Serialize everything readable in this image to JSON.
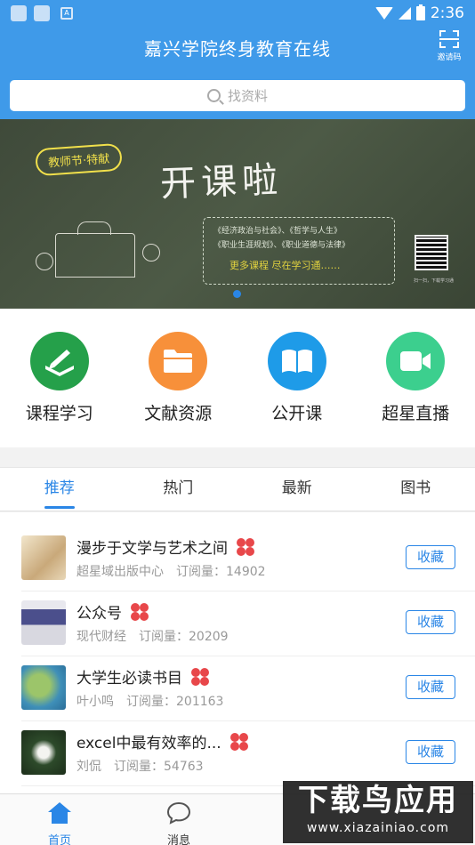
{
  "status_bar": {
    "time": "2:36"
  },
  "header": {
    "title": "嘉兴学院终身教育在线",
    "invite_label": "邀请码"
  },
  "search": {
    "placeholder": "找资料"
  },
  "banner": {
    "badge": "教师节·特献",
    "headline": "开课啦",
    "lines": [
      "《经济政治与社会》、《哲学与人生》",
      "《职业生涯规划》、《职业道德与法律》"
    ],
    "slogan": "更多课程 尽在学习通……",
    "qr_caption": "扫一扫，下载学习通"
  },
  "quick_menu": [
    {
      "label": "课程学习",
      "icon": "pen-book-icon",
      "color": "#25a04a"
    },
    {
      "label": "文献资源",
      "icon": "folder-icon",
      "color": "#f7903a"
    },
    {
      "label": "公开课",
      "icon": "open-book-icon",
      "color": "#1e9be8"
    },
    {
      "label": "超星直播",
      "icon": "video-camera-icon",
      "color": "#3ccf8e"
    }
  ],
  "tabs": [
    {
      "label": "推荐",
      "active": true
    },
    {
      "label": "热门",
      "active": false
    },
    {
      "label": "最新",
      "active": false
    },
    {
      "label": "图书",
      "active": false
    }
  ],
  "list": [
    {
      "title": "漫步于文学与艺术之间",
      "author": "超星域出版中心",
      "subs": "订阅量：14902",
      "button": "收藏"
    },
    {
      "title": "公众号",
      "author": "现代财经",
      "subs": "订阅量：20209",
      "button": "收藏"
    },
    {
      "title": "大学生必读书目",
      "author": "叶小鸣",
      "subs": "订阅量：201163",
      "button": "收藏"
    },
    {
      "title": "excel中最有效率的...",
      "author": "刘侃",
      "subs": "订阅量：54763",
      "button": "收藏"
    }
  ],
  "bottom_nav": [
    {
      "label": "首页",
      "active": true
    },
    {
      "label": "消息",
      "active": false
    }
  ],
  "watermark": {
    "big": "下载鸟应用",
    "small": "www.xiazainiao.com"
  }
}
